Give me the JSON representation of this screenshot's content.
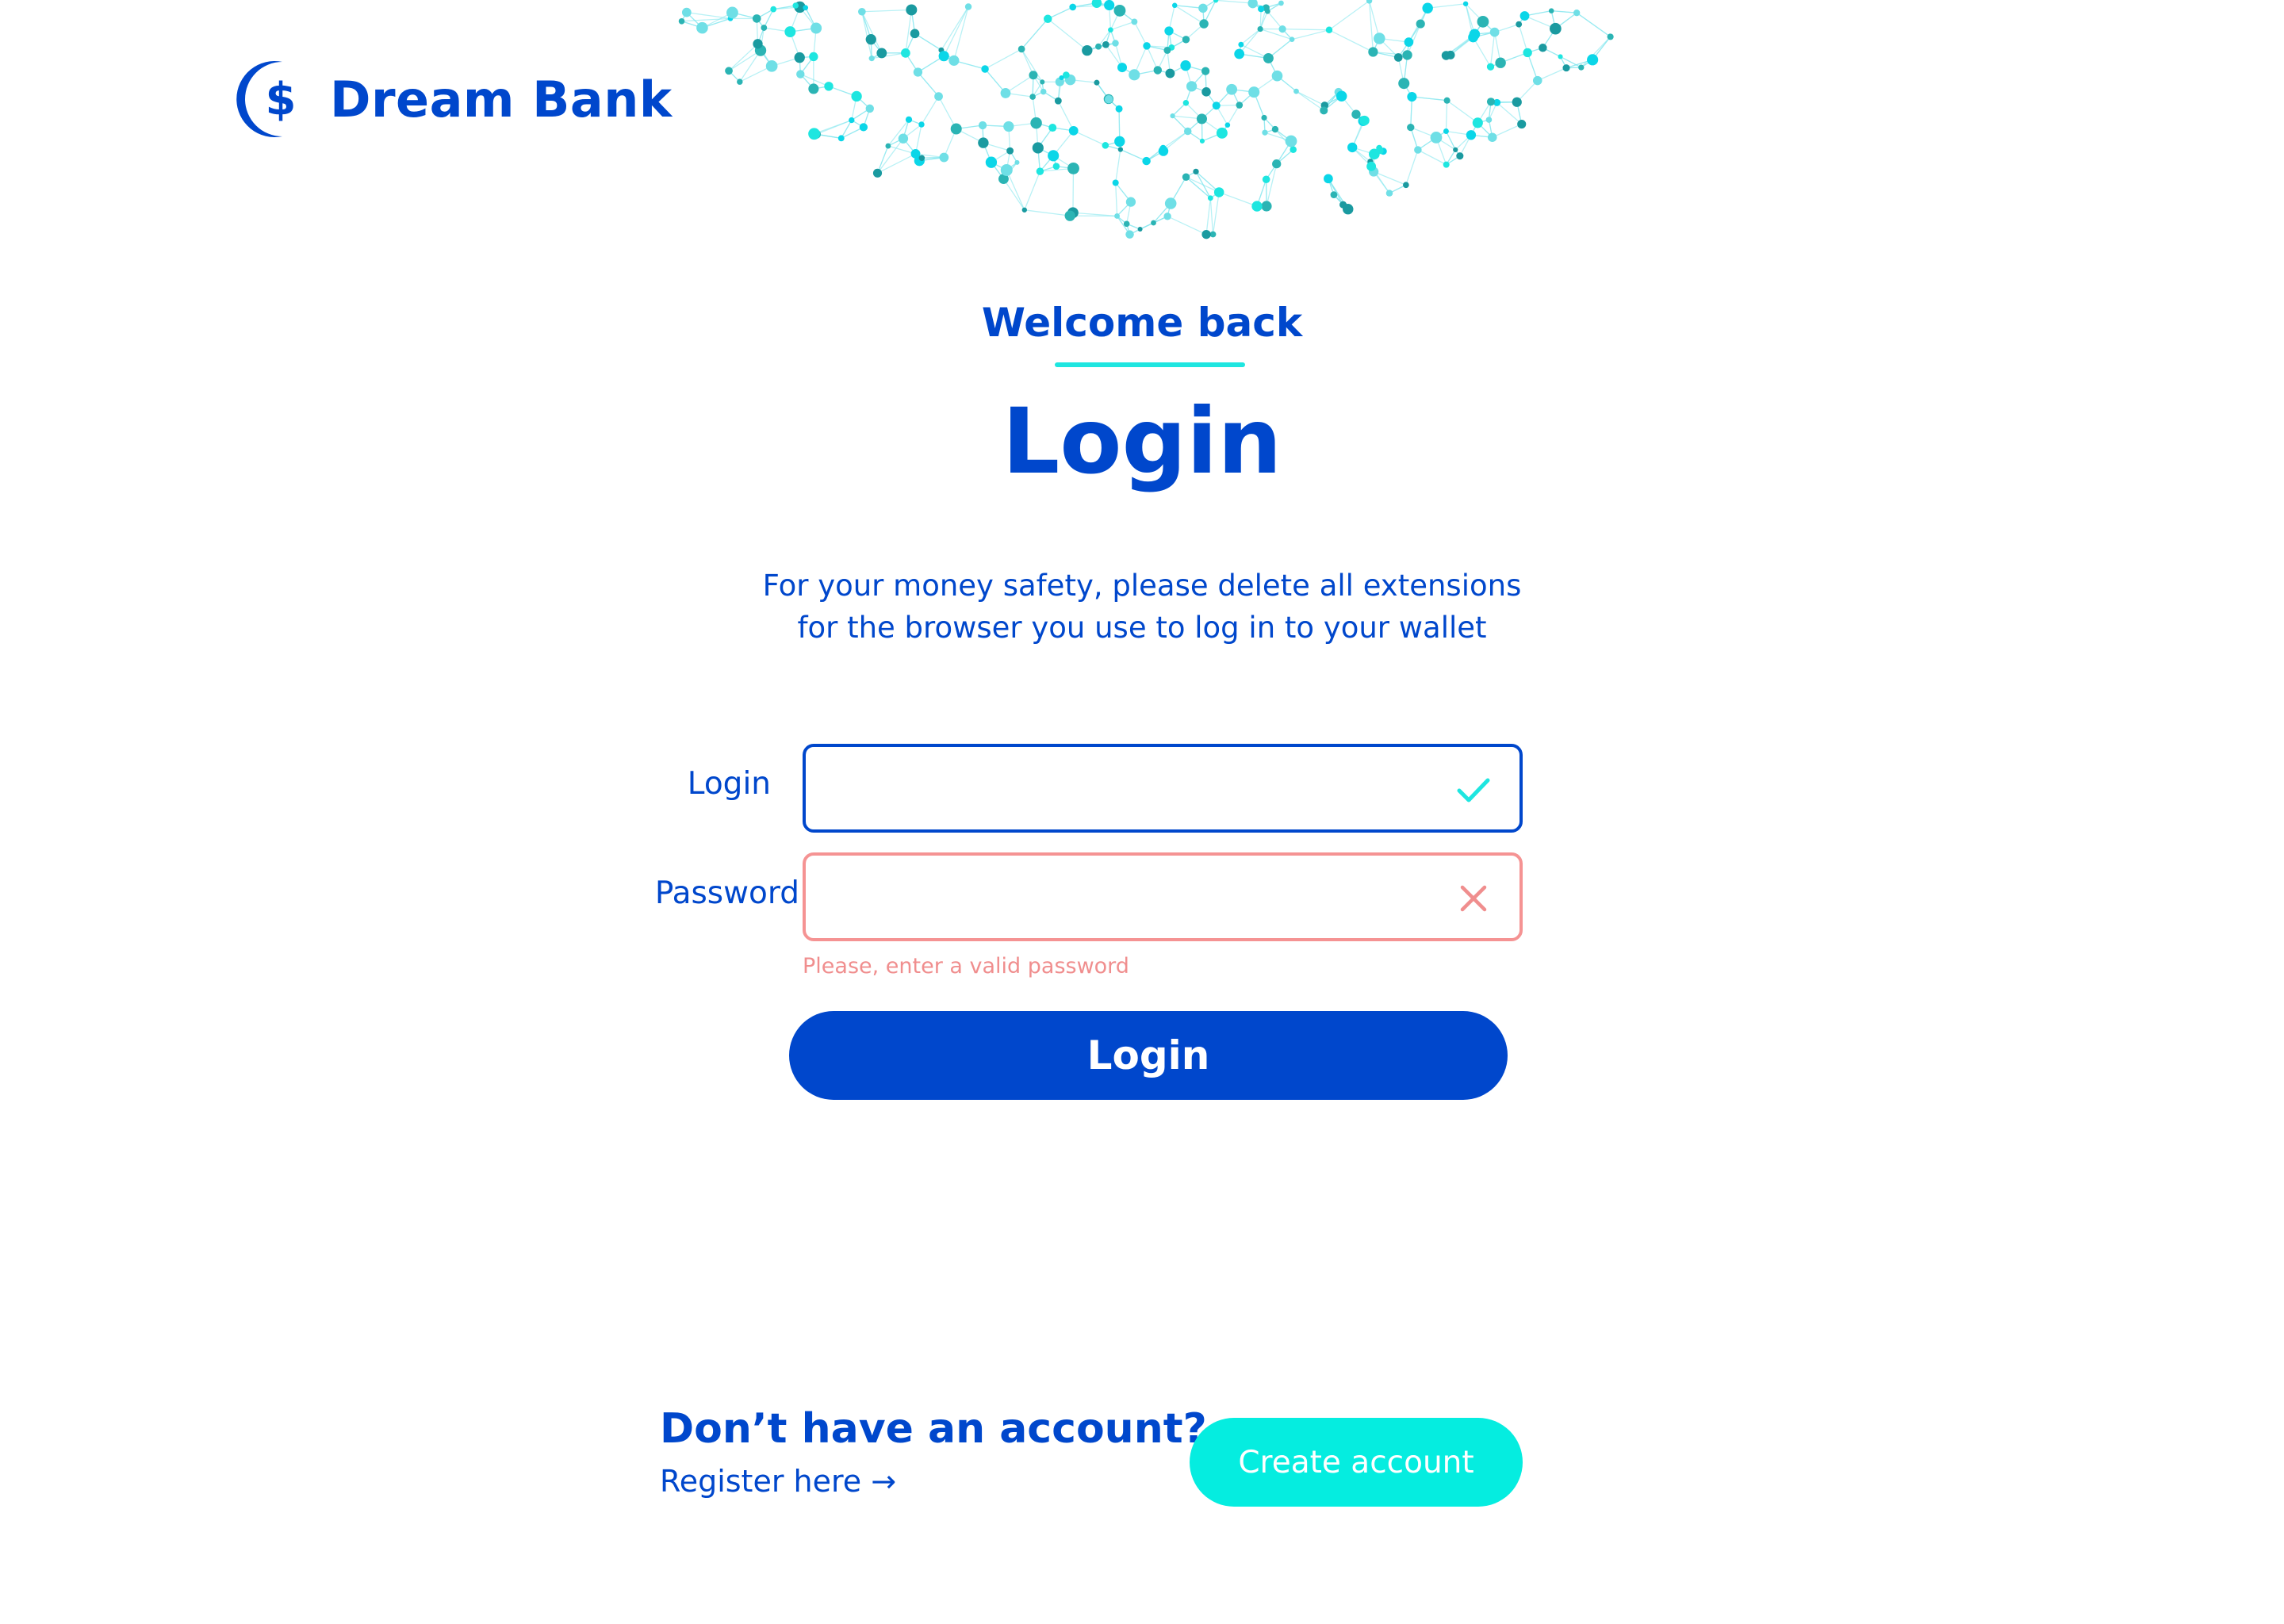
{
  "brand": {
    "name": "Dream Bank",
    "logo_icon": "crescent-dollar-icon",
    "color": "#0047cc",
    "accent": "#1ee6e0"
  },
  "header": {
    "welcome": "Welcome back",
    "title": "Login"
  },
  "notice": {
    "line1": "For your money safety, please delete all extensions",
    "line2": "for the browser you use to log in to your wallet"
  },
  "form": {
    "login": {
      "label": "Login",
      "value": "",
      "state": "valid",
      "state_icon": "check-icon"
    },
    "password": {
      "label": "Password",
      "value": "",
      "state": "invalid",
      "state_icon": "close-icon",
      "error": "Please, enter a valid password",
      "error_color": "#f08e8e"
    },
    "submit_label": "Login"
  },
  "signup": {
    "question": "Don’t have an account?",
    "register_link": "Register here →",
    "create_button": "Create account",
    "button_color": "#05ede0"
  }
}
